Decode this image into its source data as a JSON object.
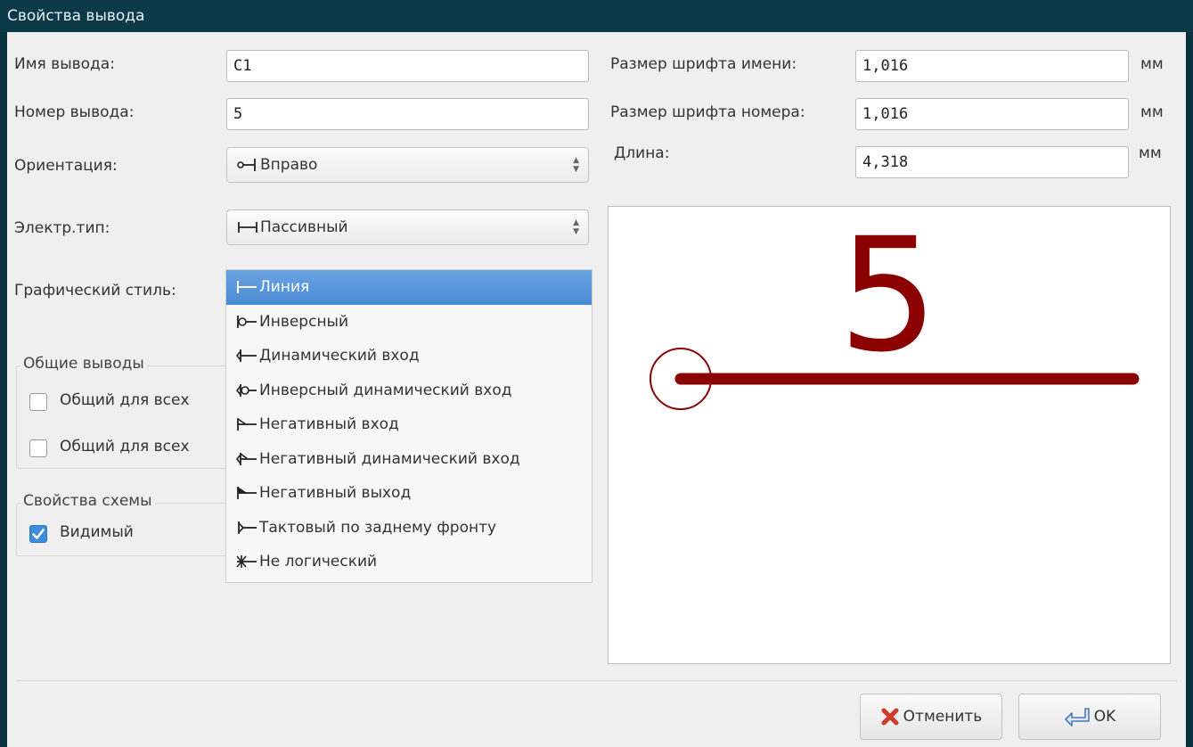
{
  "window": {
    "title": "Свойства вывода"
  },
  "form": {
    "name_label": "Имя вывода:",
    "name_value": "C1",
    "number_label": "Номер вывода:",
    "number_value": "5",
    "orientation_label": "Ориентация:",
    "orientation_value": "Вправо",
    "electrical_label": "Электр.тип:",
    "electrical_value": "Пассивный",
    "graphic_label": "Графический стиль:",
    "name_font_label": "Размер шрифта имени:",
    "name_font_value": "1,016",
    "number_font_label": "Размер шрифта номера:",
    "number_font_value": "1,016",
    "length_label": "Длина:",
    "length_value": "4,318",
    "unit": "мм"
  },
  "graphic_style_options": [
    {
      "label": "Линия",
      "icon": "line-icon",
      "selected": true
    },
    {
      "label": "Инверсный",
      "icon": "inverted-icon"
    },
    {
      "label": "Динамический вход",
      "icon": "clock-icon"
    },
    {
      "label": "Инверсный динамический вход",
      "icon": "inverted-clock-icon"
    },
    {
      "label": "Негативный вход",
      "icon": "input-low-icon"
    },
    {
      "label": "Негативный динамический вход",
      "icon": "clock-low-icon"
    },
    {
      "label": "Негативный выход",
      "icon": "output-low-icon"
    },
    {
      "label": "Тактовый по заднему фронту",
      "icon": "falling-edge-clock-icon"
    },
    {
      "label": "Не логический",
      "icon": "non-logic-icon"
    }
  ],
  "common_pins": {
    "title": "Общие выводы",
    "option1": "Общий для всех",
    "option2": "Общий для всех",
    "option1_checked": false,
    "option2_checked": false
  },
  "schematic": {
    "title": "Свойства схемы",
    "visible_label": "Видимый",
    "visible_checked": true
  },
  "preview": {
    "pin_number": "5",
    "color": "#8b0000"
  },
  "buttons": {
    "cancel": "Отменить",
    "ok": "OK"
  }
}
